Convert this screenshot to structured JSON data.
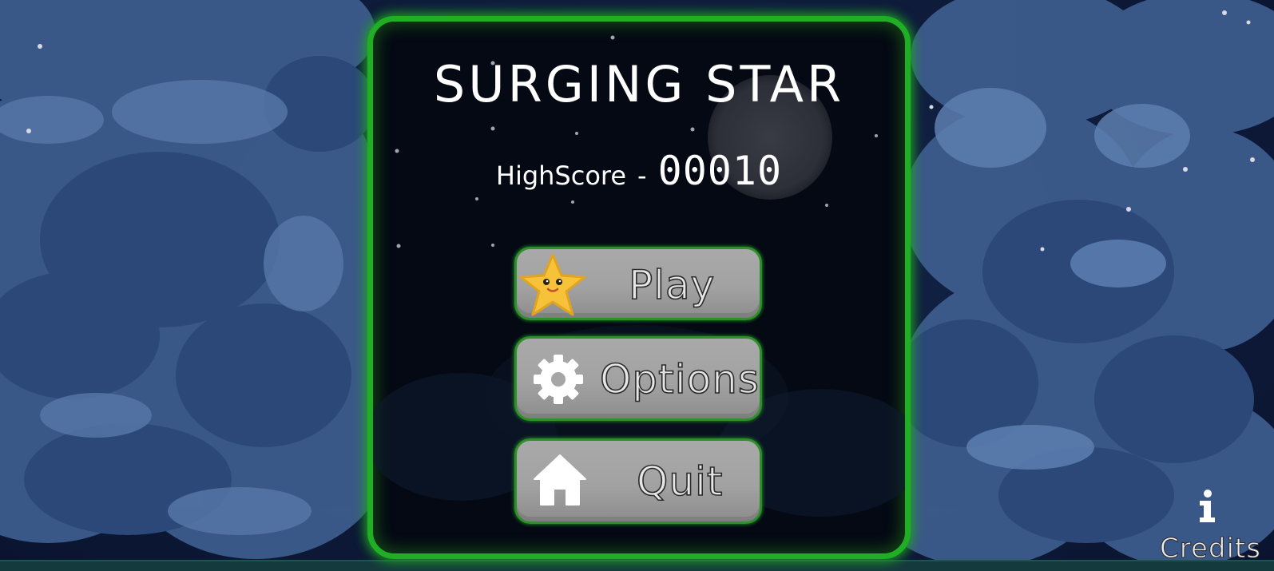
{
  "game": {
    "title": "SURGING STAR",
    "highscore_label": "HighScore",
    "highscore_separator": "-",
    "highscore_value": "00010"
  },
  "menu": {
    "play_label": "Play",
    "options_label": "Options",
    "quit_label": "Quit"
  },
  "footer": {
    "credits_label": "Credits"
  },
  "icons": {
    "play": "star-mascot-icon",
    "options": "gear-icon",
    "quit": "home-icon",
    "credits": "info-icon"
  },
  "colors": {
    "panel_border": "#1fae24",
    "panel_background": "#040913",
    "button_face": "#a6a6a6",
    "button_border": "#2f8f2b",
    "star": "#f6c23a",
    "sky": "#0d1a38"
  }
}
